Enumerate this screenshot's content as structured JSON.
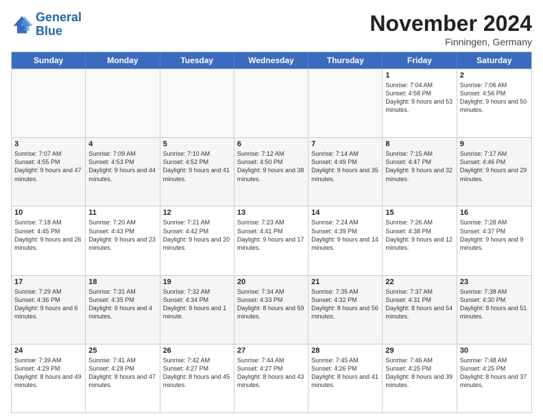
{
  "header": {
    "logo_line1": "General",
    "logo_line2": "Blue",
    "month": "November 2024",
    "location": "Finningen, Germany"
  },
  "weekdays": [
    "Sunday",
    "Monday",
    "Tuesday",
    "Wednesday",
    "Thursday",
    "Friday",
    "Saturday"
  ],
  "rows": [
    [
      {
        "day": "",
        "info": ""
      },
      {
        "day": "",
        "info": ""
      },
      {
        "day": "",
        "info": ""
      },
      {
        "day": "",
        "info": ""
      },
      {
        "day": "",
        "info": ""
      },
      {
        "day": "1",
        "info": "Sunrise: 7:04 AM\nSunset: 4:58 PM\nDaylight: 9 hours\nand 53 minutes."
      },
      {
        "day": "2",
        "info": "Sunrise: 7:06 AM\nSunset: 4:56 PM\nDaylight: 9 hours\nand 50 minutes."
      }
    ],
    [
      {
        "day": "3",
        "info": "Sunrise: 7:07 AM\nSunset: 4:55 PM\nDaylight: 9 hours\nand 47 minutes."
      },
      {
        "day": "4",
        "info": "Sunrise: 7:09 AM\nSunset: 4:53 PM\nDaylight: 9 hours\nand 44 minutes."
      },
      {
        "day": "5",
        "info": "Sunrise: 7:10 AM\nSunset: 4:52 PM\nDaylight: 9 hours\nand 41 minutes."
      },
      {
        "day": "6",
        "info": "Sunrise: 7:12 AM\nSunset: 4:50 PM\nDaylight: 9 hours\nand 38 minutes."
      },
      {
        "day": "7",
        "info": "Sunrise: 7:14 AM\nSunset: 4:49 PM\nDaylight: 9 hours\nand 35 minutes."
      },
      {
        "day": "8",
        "info": "Sunrise: 7:15 AM\nSunset: 4:47 PM\nDaylight: 9 hours\nand 32 minutes."
      },
      {
        "day": "9",
        "info": "Sunrise: 7:17 AM\nSunset: 4:46 PM\nDaylight: 9 hours\nand 29 minutes."
      }
    ],
    [
      {
        "day": "10",
        "info": "Sunrise: 7:18 AM\nSunset: 4:45 PM\nDaylight: 9 hours\nand 26 minutes."
      },
      {
        "day": "11",
        "info": "Sunrise: 7:20 AM\nSunset: 4:43 PM\nDaylight: 9 hours\nand 23 minutes."
      },
      {
        "day": "12",
        "info": "Sunrise: 7:21 AM\nSunset: 4:42 PM\nDaylight: 9 hours\nand 20 minutes."
      },
      {
        "day": "13",
        "info": "Sunrise: 7:23 AM\nSunset: 4:41 PM\nDaylight: 9 hours\nand 17 minutes."
      },
      {
        "day": "14",
        "info": "Sunrise: 7:24 AM\nSunset: 4:39 PM\nDaylight: 9 hours\nand 14 minutes."
      },
      {
        "day": "15",
        "info": "Sunrise: 7:26 AM\nSunset: 4:38 PM\nDaylight: 9 hours\nand 12 minutes."
      },
      {
        "day": "16",
        "info": "Sunrise: 7:28 AM\nSunset: 4:37 PM\nDaylight: 9 hours\nand 9 minutes."
      }
    ],
    [
      {
        "day": "17",
        "info": "Sunrise: 7:29 AM\nSunset: 4:36 PM\nDaylight: 9 hours\nand 6 minutes."
      },
      {
        "day": "18",
        "info": "Sunrise: 7:31 AM\nSunset: 4:35 PM\nDaylight: 9 hours\nand 4 minutes."
      },
      {
        "day": "19",
        "info": "Sunrise: 7:32 AM\nSunset: 4:34 PM\nDaylight: 9 hours\nand 1 minute."
      },
      {
        "day": "20",
        "info": "Sunrise: 7:34 AM\nSunset: 4:33 PM\nDaylight: 8 hours\nand 59 minutes."
      },
      {
        "day": "21",
        "info": "Sunrise: 7:35 AM\nSunset: 4:32 PM\nDaylight: 8 hours\nand 56 minutes."
      },
      {
        "day": "22",
        "info": "Sunrise: 7:37 AM\nSunset: 4:31 PM\nDaylight: 8 hours\nand 54 minutes."
      },
      {
        "day": "23",
        "info": "Sunrise: 7:38 AM\nSunset: 4:30 PM\nDaylight: 8 hours\nand 51 minutes."
      }
    ],
    [
      {
        "day": "24",
        "info": "Sunrise: 7:39 AM\nSunset: 4:29 PM\nDaylight: 8 hours\nand 49 minutes."
      },
      {
        "day": "25",
        "info": "Sunrise: 7:41 AM\nSunset: 4:28 PM\nDaylight: 8 hours\nand 47 minutes."
      },
      {
        "day": "26",
        "info": "Sunrise: 7:42 AM\nSunset: 4:27 PM\nDaylight: 8 hours\nand 45 minutes."
      },
      {
        "day": "27",
        "info": "Sunrise: 7:44 AM\nSunset: 4:27 PM\nDaylight: 8 hours\nand 43 minutes."
      },
      {
        "day": "28",
        "info": "Sunrise: 7:45 AM\nSunset: 4:26 PM\nDaylight: 8 hours\nand 41 minutes."
      },
      {
        "day": "29",
        "info": "Sunrise: 7:46 AM\nSunset: 4:25 PM\nDaylight: 8 hours\nand 39 minutes."
      },
      {
        "day": "30",
        "info": "Sunrise: 7:48 AM\nSunset: 4:25 PM\nDaylight: 8 hours\nand 37 minutes."
      }
    ]
  ]
}
